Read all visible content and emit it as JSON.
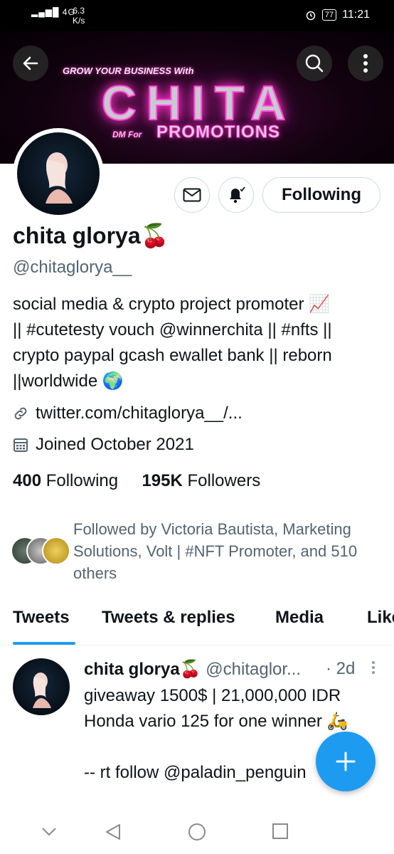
{
  "status_bar": {
    "network": "4G",
    "speed_value": "6.3",
    "speed_unit": "K/s",
    "battery": "77",
    "time": "11:21"
  },
  "banner": {
    "tagline": "GROW YOUR BUSINESS With",
    "brand": "CHITA",
    "dm_for": "DM For",
    "promotions": "PROMOTIONS"
  },
  "profile": {
    "follow_button_label": "Following",
    "name": "chita glorya",
    "name_emoji": "🍒",
    "handle": "@chitaglorya__",
    "bio": [
      "social media & crypto project promoter 📈",
      "|| #cutetesty vouch @winnerchita || #nfts ||",
      "crypto paypal gcash ewallet bank || reborn",
      "||worldwide 🌍"
    ],
    "link": "twitter.com/chitaglorya__/...",
    "joined": "Joined October 2021",
    "following_count": "400",
    "following_label": "Following",
    "followers_count": "195K",
    "followers_label": "Followers",
    "followed_by": "Followed by Victoria Bautista, Marketing Solutions, Volt | #NFT Promoter, and 510 others"
  },
  "tabs": [
    "Tweets",
    "Tweets & replies",
    "Media",
    "Likes"
  ],
  "active_tab": "Tweets",
  "tweet": {
    "author": "chita glorya",
    "author_emoji": "🍒",
    "handle": "@chitaglor...",
    "time": "· 2d",
    "lines": [
      "giveaway 1500$ | 21,000,000 IDR",
      "Honda vario 125 for one winner 🛵",
      "",
      "-- rt follow @paladin_penguin"
    ]
  },
  "colors": {
    "accent": "#1d9bf0",
    "text": "#0f1419",
    "secondary": "#536471",
    "banner_glow": "#ff2fc6"
  },
  "icons": [
    "back-arrow-icon",
    "search-icon",
    "more-vertical-icon",
    "mail-icon",
    "bell-plus-icon",
    "link-icon",
    "calendar-icon",
    "plus-icon",
    "nav-down-icon",
    "nav-back-icon",
    "nav-home-icon",
    "nav-recents-icon"
  ]
}
